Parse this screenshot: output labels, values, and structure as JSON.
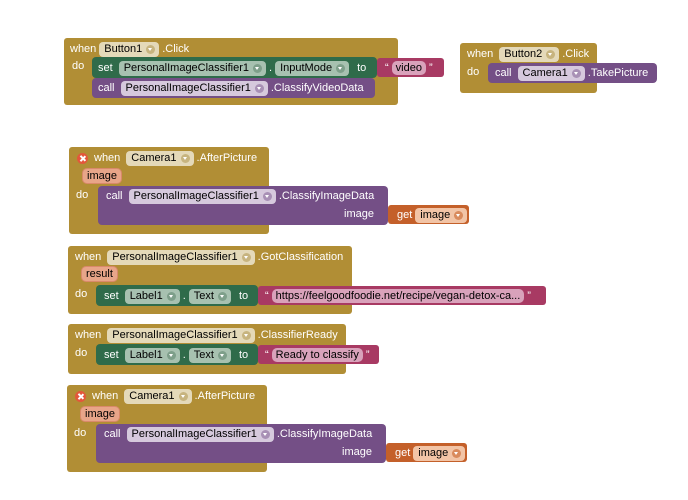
{
  "blocks": {
    "b1": {
      "when": "when",
      "component": "Button1",
      "event": ".Click",
      "do": "do",
      "set": {
        "kw": "set",
        "component": "PersonalImageClassifier1",
        "dot": ".",
        "property": "InputMode",
        "to": "to",
        "value": "video"
      },
      "call": {
        "kw": "call",
        "component": "PersonalImageClassifier1",
        "method": ".ClassifyVideoData"
      }
    },
    "b2": {
      "when": "when",
      "component": "Button2",
      "event": ".Click",
      "do": "do",
      "call": {
        "kw": "call",
        "component": "Camera1",
        "method": ".TakePicture"
      }
    },
    "b3": {
      "when": "when",
      "component": "Camera1",
      "event": ".AfterPicture",
      "param": "image",
      "do": "do",
      "call": {
        "kw": "call",
        "component": "PersonalImageClassifier1",
        "method": ".ClassifyImageData",
        "arg_label": "image"
      },
      "get": {
        "kw": "get",
        "var": "image"
      }
    },
    "b4": {
      "when": "when",
      "component": "PersonalImageClassifier1",
      "event": ".GotClassification",
      "param": "result",
      "do": "do",
      "set": {
        "kw": "set",
        "component": "Label1",
        "dot": ".",
        "property": "Text",
        "to": "to",
        "value": "https://feelgoodfoodie.net/recipe/vegan-detox-ca..."
      }
    },
    "b5": {
      "when": "when",
      "component": "PersonalImageClassifier1",
      "event": ".ClassifierReady",
      "do": "do",
      "set": {
        "kw": "set",
        "component": "Label1",
        "dot": ".",
        "property": "Text",
        "to": "to",
        "value": "Ready to classify"
      }
    },
    "b6": {
      "when": "when",
      "component": "Camera1",
      "event": ".AfterPicture",
      "param": "image",
      "do": "do",
      "call": {
        "kw": "call",
        "component": "PersonalImageClassifier1",
        "method": ".ClassifyImageData",
        "arg_label": "image"
      },
      "get": {
        "kw": "get",
        "var": "image"
      }
    }
  },
  "quote_open": "“",
  "quote_close": "”"
}
